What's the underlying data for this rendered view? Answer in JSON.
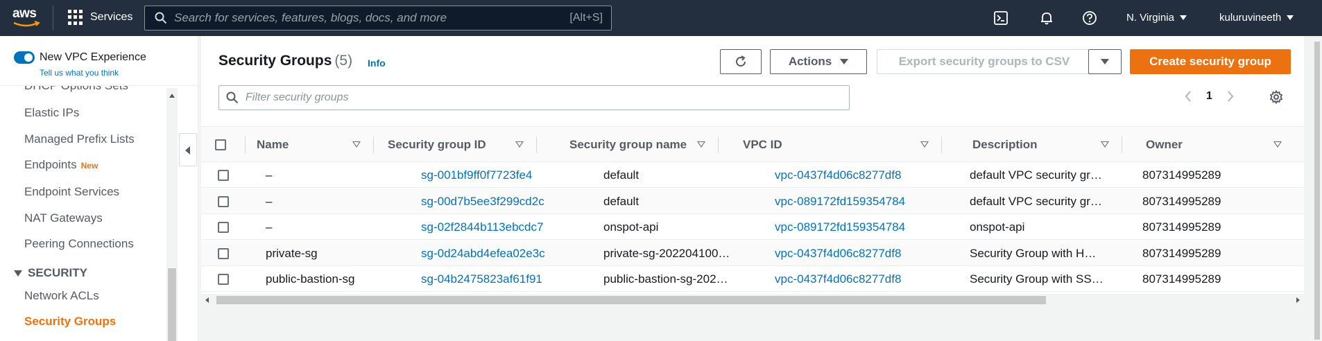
{
  "topnav": {
    "logo_text": "aws",
    "services_label": "Services",
    "search_placeholder": "Search for services, features, blogs, docs, and more",
    "search_shortcut": "[Alt+S]",
    "region": "N. Virginia",
    "user": "kuluruvineeth",
    "icons": [
      "cloudshell-icon",
      "notifications-bell-icon",
      "help-icon"
    ]
  },
  "sidebar": {
    "vpc_experience_label": "New VPC Experience",
    "tell_us": "Tell us what you think",
    "items": [
      {
        "label": "DHCP Options Sets"
      },
      {
        "label": "Elastic IPs"
      },
      {
        "label": "Managed Prefix Lists"
      },
      {
        "label": "Endpoints",
        "badge": "New"
      },
      {
        "label": "Endpoint Services"
      },
      {
        "label": "NAT Gateways"
      },
      {
        "label": "Peering Connections"
      }
    ],
    "section": "SECURITY",
    "security_items": [
      {
        "label": "Network ACLs"
      },
      {
        "label": "Security Groups"
      }
    ]
  },
  "main": {
    "title": "Security Groups",
    "count": "(5)",
    "info": "Info",
    "actions_label": "Actions",
    "export_label": "Export security groups to CSV",
    "create_label": "Create security group",
    "filter_placeholder": "Filter security groups",
    "page": "1"
  },
  "table": {
    "columns": [
      "Name",
      "Security group ID",
      "Security group name",
      "VPC ID",
      "Description",
      "Owner"
    ],
    "rows": [
      {
        "name": "–",
        "sg_id": "sg-001bf9ff0f7723fe4",
        "sg_name": "default",
        "vpc_id": "vpc-0437f4d06c8277df8",
        "description": "default VPC security gr…",
        "owner": "807314995289"
      },
      {
        "name": "–",
        "sg_id": "sg-00d7b5ee3f299cd2c",
        "sg_name": "default",
        "vpc_id": "vpc-089172fd159354784",
        "description": "default VPC security gr…",
        "owner": "807314995289"
      },
      {
        "name": "–",
        "sg_id": "sg-02f2844b113ebcdc7",
        "sg_name": "onspot-api",
        "vpc_id": "vpc-089172fd159354784",
        "description": "onspot-api",
        "owner": "807314995289"
      },
      {
        "name": "private-sg",
        "sg_id": "sg-0d24abd4efea02e3c",
        "sg_name": "private-sg-202204100…",
        "vpc_id": "vpc-0437f4d06c8277df8",
        "description": "Security Group with H…",
        "owner": "807314995289"
      },
      {
        "name": "public-bastion-sg",
        "sg_id": "sg-04b2475823af61f91",
        "sg_name": "public-bastion-sg-202…",
        "vpc_id": "vpc-0437f4d06c8277df8",
        "description": "Security Group with SS…",
        "owner": "807314995289"
      }
    ]
  },
  "colors": {
    "nav_bg": "#232f3e",
    "accent_orange": "#ec7211",
    "link_blue": "#0073bb"
  }
}
